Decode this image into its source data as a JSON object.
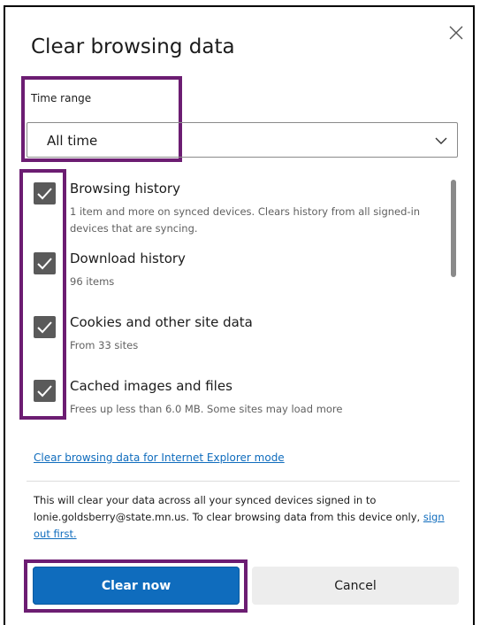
{
  "dialog": {
    "title": "Clear browsing data",
    "close_icon": "close-icon"
  },
  "time_range": {
    "label": "Time range",
    "selected": "All time",
    "chevron_icon": "chevron-down-icon"
  },
  "items": [
    {
      "title": "Browsing history",
      "description": "1 item and more on synced devices. Clears history from all signed-in devices that are syncing.",
      "checked": true
    },
    {
      "title": "Download history",
      "description": "96 items",
      "checked": true
    },
    {
      "title": "Cookies and other site data",
      "description": "From 33 sites",
      "checked": true
    },
    {
      "title": "Cached images and files",
      "description": "Frees up less than 6.0 MB. Some sites may load more",
      "checked": true
    }
  ],
  "ie_link": "Clear browsing data for Internet Explorer mode",
  "info": {
    "text": "This will clear your data across all your synced devices signed in to lonie.goldsberry@state.mn.us. To clear browsing data from this device only,",
    "link": "sign out first."
  },
  "buttons": {
    "primary": "Clear now",
    "secondary": "Cancel"
  },
  "colors": {
    "highlight": "#6c1d72",
    "accent": "#0f6cbd",
    "checkbox": "#5a5a5a"
  }
}
